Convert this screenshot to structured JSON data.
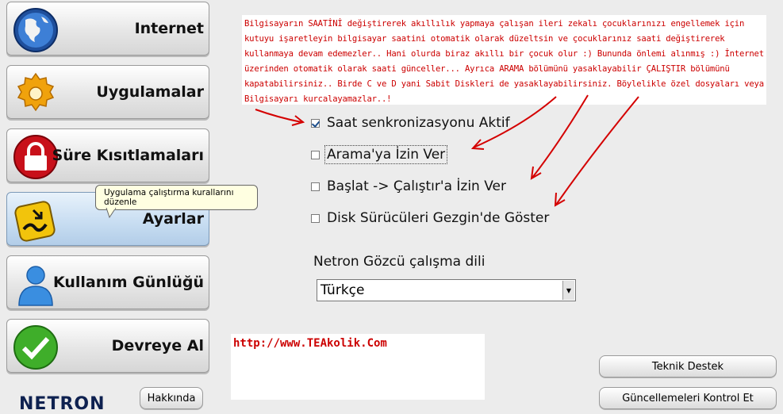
{
  "nav": [
    {
      "label": "Internet",
      "icon": "globe-icon"
    },
    {
      "label": "Uygulamalar",
      "icon": "gear-icon"
    },
    {
      "label": "Süre Kısıtlamaları",
      "icon": "lock-icon"
    },
    {
      "label": "Ayarlar",
      "icon": "settings-tool-icon",
      "active": true
    },
    {
      "label": "Kullanım Günlüğü",
      "icon": "user-icon"
    },
    {
      "label": "Devreye Al",
      "icon": "checkmark-icon"
    }
  ],
  "tooltip": "Uygulama çalıştırma kurallarını düzenle",
  "note": "Bilgisayarın SAATİNİ değiştirerek akıllılık yapmaya çalışan ileri zekalı çocuklarınızı engellemek için kutuyu işaretleyin bilgisayar saatini otomatik olarak düzeltsin ve çocuklarınız saati değiştirerek kullanmaya devam edemezler.. Hani olurda biraz akıllı bir çocuk olur :) Bununda önlemi alınmış :) İnternet üzerinden otomatik olarak saati günceller... Ayrıca ARAMA bölümünü yasaklayabilir ÇALIŞTIR bölümünü kapatabilirsiniz.. Birde C ve D yani Sabit Diskleri de yasaklayabilirsiniz. Böylelikle özel dosyaları veya Bilgisayarı kurcalayamazlar..!",
  "options": [
    {
      "label": "Saat senkronizasyonu Aktif",
      "checked": true
    },
    {
      "label": "Arama'ya İzin Ver",
      "checked": false,
      "focused": true
    },
    {
      "label": "Başlat -> Çalıştır'a İzin Ver",
      "checked": false
    },
    {
      "label": "Disk Sürücüleri Gezgin'de Göster",
      "checked": false
    }
  ],
  "language": {
    "label": "Netron Gözcü çalışma dili",
    "selected": "Türkçe"
  },
  "url": "http://www.TEAkolik.Com",
  "buttons": {
    "about": "Hakkında",
    "support": "Teknik Destek",
    "update": "Güncellemeleri Kontrol Et"
  },
  "logo": "NETRON",
  "colors": {
    "annotation": "#cc0000",
    "active_nav": "#c9def2"
  }
}
